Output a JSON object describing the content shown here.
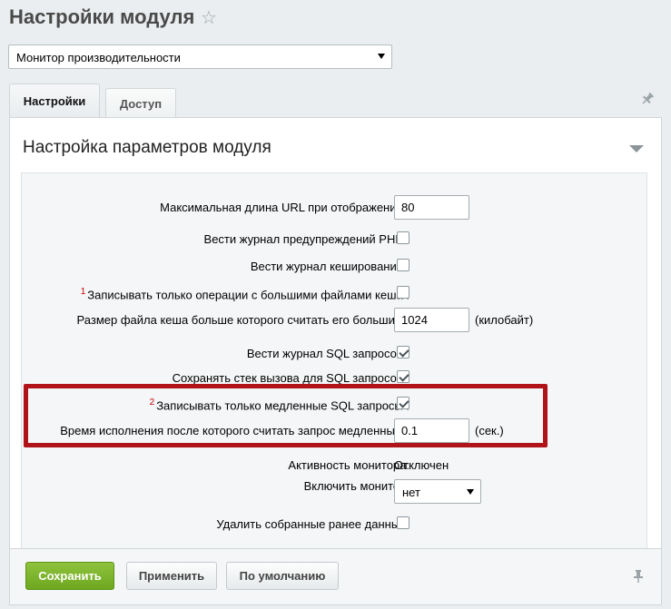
{
  "page": {
    "title": "Настройки модуля"
  },
  "module_select": {
    "value": "Монитор производительности"
  },
  "tabs": [
    {
      "label": "Настройки",
      "active": true
    },
    {
      "label": "Доступ",
      "active": false
    }
  ],
  "section": {
    "title": "Настройка параметров модуля"
  },
  "fields": {
    "max_url_length": {
      "label": "Максимальная длина URL при отображении :",
      "value": "80"
    },
    "log_php_warnings": {
      "label": "Вести журнал предупреждений PHP :",
      "checked": false
    },
    "log_caching": {
      "label": "Вести журнал кеширования :",
      "checked": false
    },
    "log_big_cache_only": {
      "footnote": "1",
      "label": "Записывать только операции с большими файлами кеша :",
      "checked": false
    },
    "big_cache_size": {
      "label": "Размер файла кеша больше которого считать его большим :",
      "value": "1024",
      "unit": "(килобайт)"
    },
    "log_sql": {
      "label": "Вести журнал SQL запросов :",
      "checked": true
    },
    "save_sql_stack": {
      "label": "Сохранять стек вызова для SQL запросов :",
      "checked": true
    },
    "log_slow_sql_only": {
      "footnote": "2",
      "label": "Записывать только медленные SQL запросы :",
      "checked": true
    },
    "slow_sql_time": {
      "label": "Время исполнения после которого считать запрос медленным :",
      "value": "0.1",
      "unit": "(сек.)"
    },
    "monitor_status": {
      "label": "Активность монитора:",
      "value": "Отключен"
    },
    "enable_monitor": {
      "label": "Включить монитор:",
      "value": "нет"
    },
    "delete_collected": {
      "label": "Удалить собранные ранее данные:",
      "checked": false
    }
  },
  "buttons": {
    "save": "Сохранить",
    "apply": "Применить",
    "default": "По умолчанию"
  },
  "colors": {
    "highlight_border": "#b01318",
    "save_button": "#7ab52c",
    "footnote": "#cc0000"
  },
  "icons": [
    "star-icon",
    "pin-icon",
    "chevron-down-icon",
    "checkmark-icon"
  ]
}
